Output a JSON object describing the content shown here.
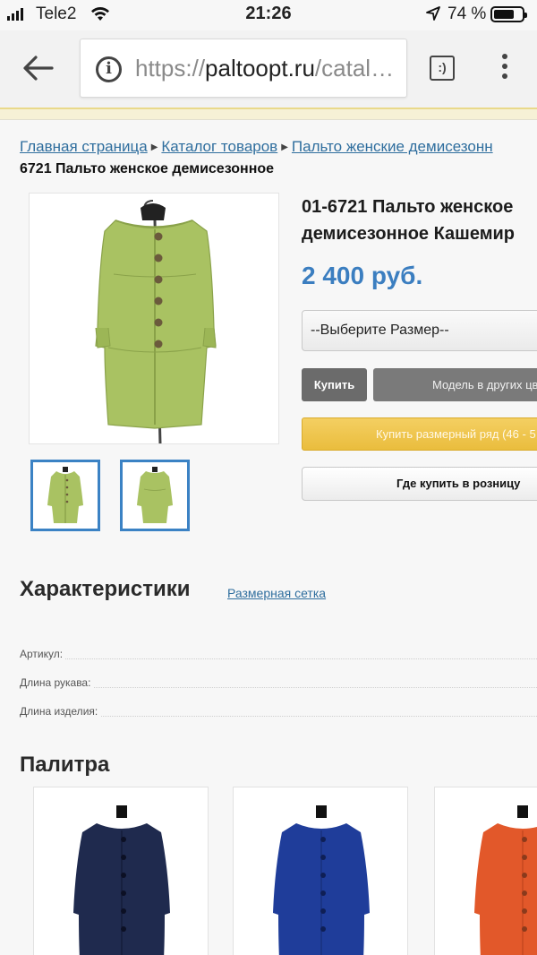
{
  "status_bar": {
    "carrier": "Tele2",
    "time": "21:26",
    "battery_percent": "74 %",
    "battery_level": 0.74
  },
  "browser": {
    "url": {
      "scheme": "https://",
      "host": "paltoopt.ru",
      "path": "/catal…"
    }
  },
  "breadcrumb": {
    "items": [
      "Главная страница",
      "Каталог товаров",
      "Пальто женские демисезонн"
    ],
    "current": "6721 Пальто женское демисезонное"
  },
  "product": {
    "title_line1": "01-6721 Пальто женское",
    "title_line2": "демисезонное Кашемир",
    "price": "2 400 руб.",
    "size_select": "--Выберите Размер--",
    "buy_label": "Купить",
    "other_colors_label": "Модель в других цве",
    "size_range_label": "Купить размерный ряд (46 - 5",
    "retail_label": "Где купить в розницу"
  },
  "specs": {
    "title": "Характеристики",
    "size_chart_link": "Размерная сетка",
    "rows": [
      "Артикул:",
      "Длина рукава:",
      "Длина изделия:"
    ]
  },
  "palette": {
    "title": "Палитра"
  },
  "colors": {
    "accent_blue": "#3b7ec0",
    "coat_green": "#a9c262",
    "coat_navy": "#1f2a4e",
    "coat_blue": "#1f3d9a",
    "coat_orange": "#e2582a",
    "buy_yellow": "#f0c448"
  },
  "icons": [
    "signal-icon",
    "wifi-icon",
    "location-arrow-icon",
    "battery-icon",
    "back-arrow-icon",
    "info-icon",
    "reader-mode-icon",
    "more-menu-icon",
    "breadcrumb-separator-icon"
  ]
}
